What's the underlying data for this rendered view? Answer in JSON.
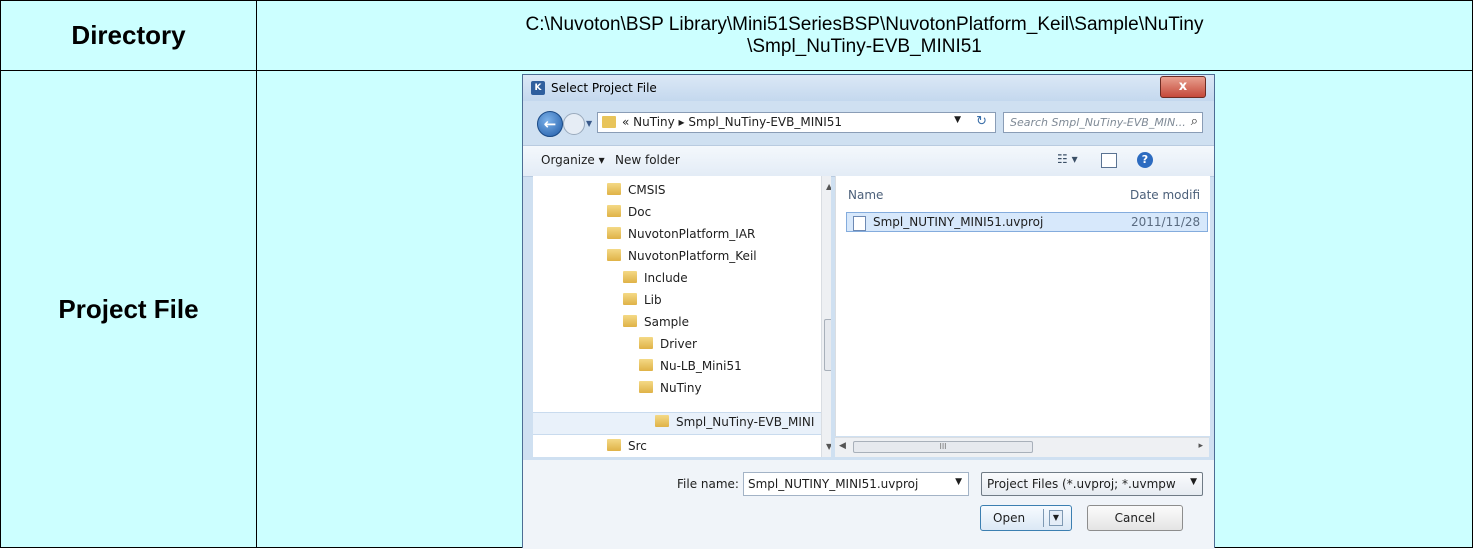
{
  "table": {
    "row1_header": "Directory",
    "path_line1": "C:\\Nuvoton\\BSP Library\\Mini51SeriesBSP\\NuvotonPlatform_Keil\\Sample\\NuTiny",
    "path_line2": "\\Smpl_NuTiny-EVB_MINI51",
    "row2_header": "Project File"
  },
  "dialog": {
    "title": "Select Project File",
    "close_glyph": "x",
    "back_glyph": "←",
    "breadcrumb": "« NuTiny ▸ Smpl_NuTiny-EVB_MINI51",
    "search_placeholder": "Search Smpl_NuTiny-EVB_MIN...",
    "toolbar": {
      "organize": "Organize ▾",
      "new_folder": "New folder",
      "views_glyph": "☷ ▾",
      "help_glyph": "?"
    },
    "tree": [
      {
        "label": "CMSIS"
      },
      {
        "label": "Doc"
      },
      {
        "label": "NuvotonPlatform_IAR"
      },
      {
        "label": "NuvotonPlatform_Keil"
      },
      {
        "label": "Include"
      },
      {
        "label": "Lib"
      },
      {
        "label": "Sample"
      },
      {
        "label": "Driver"
      },
      {
        "label": "Nu-LB_Mini51"
      },
      {
        "label": "NuTiny"
      },
      {
        "label": "Smpl_NuTiny-EVB_MINI"
      },
      {
        "label": "Src"
      }
    ],
    "columns": {
      "name": "Name",
      "date": "Date modifi"
    },
    "files": [
      {
        "name": "Smpl_NUTINY_MINI51.uvproj",
        "date": "2011/11/28"
      }
    ],
    "file_name_label": "File name:",
    "file_name_value": "Smpl_NUTINY_MINI51.uvproj",
    "file_type": "Project Files (*.uvproj; *.uvmpw",
    "open_label": "Open",
    "cancel_label": "Cancel"
  }
}
